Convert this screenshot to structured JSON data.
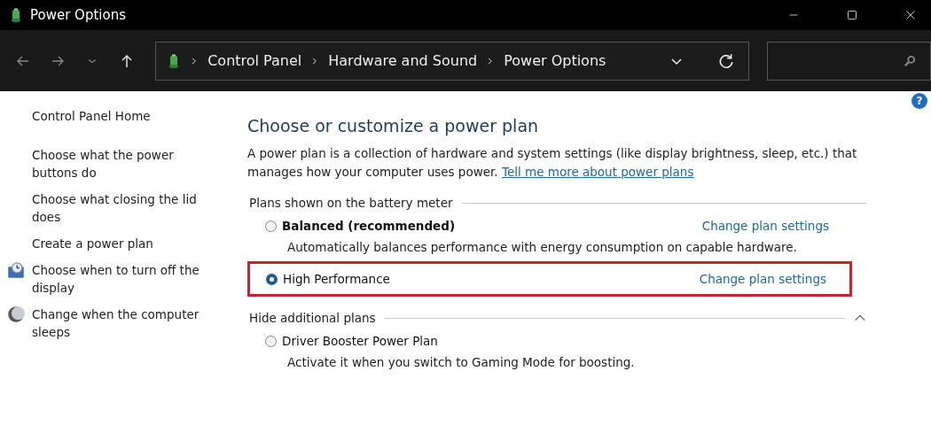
{
  "window": {
    "title": "Power Options"
  },
  "navigation": {
    "breadcrumbs": [
      "Control Panel",
      "Hardware and Sound",
      "Power Options"
    ]
  },
  "help": "?",
  "sidebar": {
    "items": [
      {
        "label": "Control Panel Home",
        "kind": "home"
      },
      {
        "label": "Choose what the power buttons do",
        "kind": "link"
      },
      {
        "label": "Choose what closing the lid does",
        "kind": "link"
      },
      {
        "label": "Create a power plan",
        "kind": "link"
      },
      {
        "label": "Choose when to turn off the display",
        "kind": "display"
      },
      {
        "label": "Change when the computer sleeps",
        "kind": "sleep"
      }
    ]
  },
  "main": {
    "title": "Choose or customize a power plan",
    "intro": "A power plan is a collection of hardware and system settings (like display brightness, sleep, etc.) that manages how your computer uses power.",
    "intro_link": "Tell me more about power plans",
    "groups": [
      {
        "heading": "Plans shown on the battery meter",
        "kind": "static",
        "plans": [
          {
            "name": "Balanced (recommended)",
            "bold": true,
            "selected": false,
            "highlighted": false,
            "link": "Change plan settings",
            "description": "Automatically balances performance with energy consumption on capable hardware."
          },
          {
            "name": "High Performance",
            "bold": false,
            "selected": true,
            "highlighted": true,
            "link": "Change plan settings"
          }
        ]
      },
      {
        "heading": "Hide additional plans",
        "kind": "collapsible",
        "plans": [
          {
            "name": "Driver Booster Power Plan",
            "bold": false,
            "selected": false,
            "highlighted": false,
            "description": "Activate it when you switch to Gaming Mode for boosting."
          }
        ]
      }
    ]
  }
}
